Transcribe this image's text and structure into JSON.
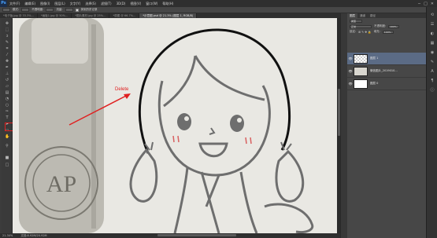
{
  "app": {
    "logo": "Ps"
  },
  "menus": [
    "文件(F)",
    "编辑(E)",
    "图像(I)",
    "图层(L)",
    "文字(Y)",
    "选择(S)",
    "滤镜(T)",
    "3D(D)",
    "视图(V)",
    "窗口(W)",
    "帮助(H)"
  ],
  "window_controls": [
    "─",
    "□",
    "✕"
  ],
  "options": {
    "mode_label": "模式:",
    "opacity_label": "不透明度:",
    "flow_label": "流量:",
    "erase_history_label": "抹到历史记录"
  },
  "tabs": [
    {
      "label": "*电子版.jpg @ 33.3%...",
      "active": false
    },
    {
      "label": "*画板1.jpg @ 50%...",
      "active": false
    },
    {
      "label": "*图片素材.jpg @ 25%...",
      "active": false
    },
    {
      "label": "*原图 @ 66.7%...",
      "active": false
    },
    {
      "label": "*示意图.psd @ 21.3% (图层 1, RGB/8)",
      "active": true
    }
  ],
  "canvas": {
    "annotation_text": "Delete",
    "annotation_color": "#e02020",
    "bottle_text": "AP"
  },
  "status": {
    "zoom": "21.34%",
    "doc": "文档:8.92M/20.92M"
  },
  "panel": {
    "tabs": [
      "图层",
      "通道",
      "路径"
    ],
    "kind_label": "类型",
    "blend_mode": "正常",
    "opacity_label": "不透明度:",
    "opacity_value": "100%",
    "lock_label": "锁定:",
    "fill_label": "填充:",
    "fill_value": "100%",
    "layers": [
      {
        "name": "图层 1",
        "selected": true,
        "thumb": "checker"
      },
      {
        "name": "微信图片_2019010...",
        "selected": false,
        "thumb": "photo"
      },
      {
        "name": "图层 0",
        "selected": false,
        "thumb": "white"
      }
    ]
  },
  "icons": {
    "tools": [
      "move-icon",
      "marquee-icon",
      "lasso-icon",
      "quick-select-icon",
      "crop-icon",
      "eyedropper-icon",
      "healing-icon",
      "brush-icon",
      "clone-stamp-icon",
      "history-brush-icon",
      "eraser-icon",
      "gradient-icon",
      "blur-icon",
      "dodge-icon",
      "pen-icon",
      "type-icon",
      "path-select-icon",
      "shape-icon",
      "hand-icon",
      "zoom-icon"
    ],
    "eye": "eye-icon"
  }
}
